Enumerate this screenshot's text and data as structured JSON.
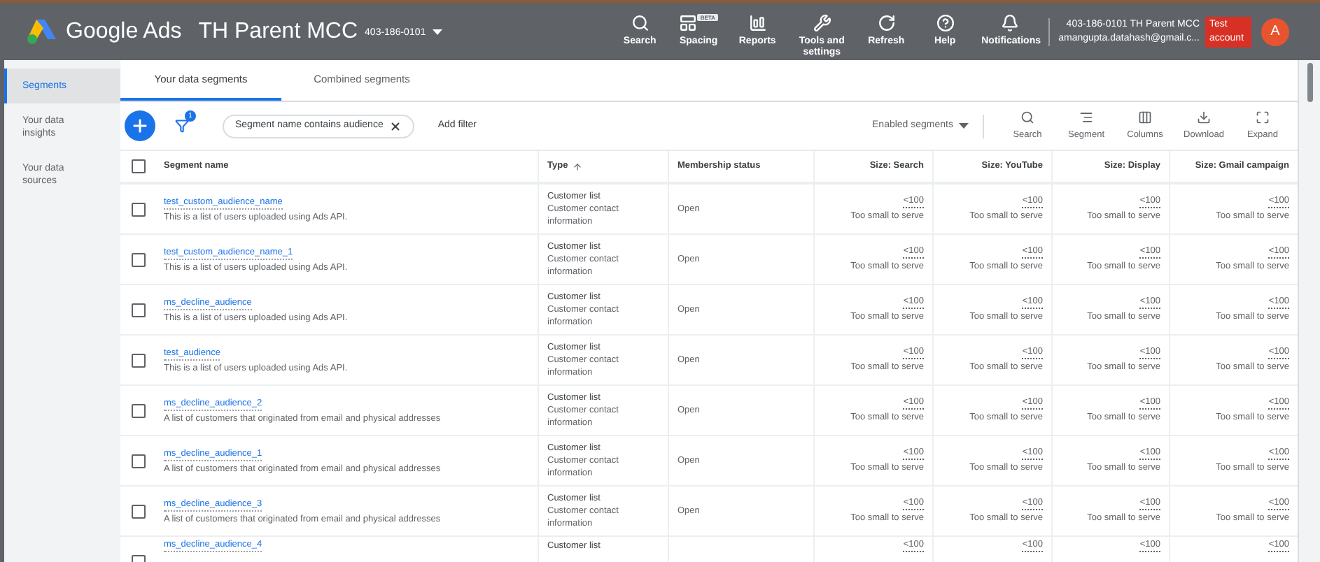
{
  "header": {
    "product": "Google Ads",
    "account_name": "TH Parent MCC",
    "account_id": "403-186-0101",
    "nav": [
      {
        "kind": "search",
        "label": "Search"
      },
      {
        "kind": "spacing",
        "label": "Spacing",
        "badge": "BETA"
      },
      {
        "kind": "reports",
        "label": "Reports"
      },
      {
        "kind": "tools",
        "label": "Tools and settings"
      },
      {
        "kind": "refresh",
        "label": "Refresh"
      },
      {
        "kind": "help",
        "label": "Help"
      },
      {
        "kind": "notifications",
        "label": "Notifications"
      }
    ],
    "user": {
      "account": "403-186-0101 TH Parent MCC",
      "email": "amangupta.datahash@gmail.c...",
      "badge": "Test account",
      "avatar": "A"
    }
  },
  "sidebar": {
    "items": [
      {
        "label": "Segments",
        "selected": true
      },
      {
        "label": "Your data insights",
        "selected": false
      },
      {
        "label": "Your data sources",
        "selected": false
      }
    ]
  },
  "tabs": [
    {
      "label": "Your data segments",
      "selected": true
    },
    {
      "label": "Combined segments",
      "selected": false
    }
  ],
  "toolbar": {
    "filter_count": "1",
    "filter_chip": "Segment name contains audience",
    "add_filter": "Add filter",
    "status_dropdown": "Enabled segments",
    "actions": [
      {
        "kind": "search",
        "label": "Search"
      },
      {
        "kind": "segment",
        "label": "Segment"
      },
      {
        "kind": "columns",
        "label": "Columns"
      },
      {
        "kind": "download",
        "label": "Download"
      },
      {
        "kind": "expand",
        "label": "Expand"
      }
    ]
  },
  "table": {
    "select_all_checked": false,
    "columns": [
      {
        "label": "Segment name",
        "sorted": false
      },
      {
        "label": "Type",
        "sorted": true
      },
      {
        "label": "Membership status",
        "sorted": false
      },
      {
        "label": "Size: Search",
        "sorted": false
      },
      {
        "label": "Size: YouTube",
        "sorted": false
      },
      {
        "label": "Size: Display",
        "sorted": false
      },
      {
        "label": "Size: Gmail campaign",
        "sorted": false
      }
    ],
    "rows": [
      {
        "checked": false,
        "name": "test_custom_audience_name",
        "description": "This is a list of users uploaded using Ads API.",
        "type": "Customer list",
        "type_detail": "Customer contact information",
        "status": "Open",
        "sizes": [
          {
            "value": "<100",
            "note": "Too small to serve"
          },
          {
            "value": "<100",
            "note": "Too small to serve"
          },
          {
            "value": "<100",
            "note": "Too small to serve"
          },
          {
            "value": "<100",
            "note": "Too small to serve"
          }
        ]
      },
      {
        "checked": false,
        "name": "test_custom_audience_name_1",
        "description": "This is a list of users uploaded using Ads API.",
        "type": "Customer list",
        "type_detail": "Customer contact information",
        "status": "Open",
        "sizes": [
          {
            "value": "<100",
            "note": "Too small to serve"
          },
          {
            "value": "<100",
            "note": "Too small to serve"
          },
          {
            "value": "<100",
            "note": "Too small to serve"
          },
          {
            "value": "<100",
            "note": "Too small to serve"
          }
        ]
      },
      {
        "checked": false,
        "name": "ms_decline_audience",
        "description": "This is a list of users uploaded using Ads API.",
        "type": "Customer list",
        "type_detail": "Customer contact information",
        "status": "Open",
        "sizes": [
          {
            "value": "<100",
            "note": "Too small to serve"
          },
          {
            "value": "<100",
            "note": "Too small to serve"
          },
          {
            "value": "<100",
            "note": "Too small to serve"
          },
          {
            "value": "<100",
            "note": "Too small to serve"
          }
        ]
      },
      {
        "checked": false,
        "name": "test_audience",
        "description": "This is a list of users uploaded using Ads API.",
        "type": "Customer list",
        "type_detail": "Customer contact information",
        "status": "Open",
        "sizes": [
          {
            "value": "<100",
            "note": "Too small to serve"
          },
          {
            "value": "<100",
            "note": "Too small to serve"
          },
          {
            "value": "<100",
            "note": "Too small to serve"
          },
          {
            "value": "<100",
            "note": "Too small to serve"
          }
        ]
      },
      {
        "checked": false,
        "name": "ms_decline_audience_2",
        "description": "A list of customers that originated from email and physical addresses",
        "type": "Customer list",
        "type_detail": "Customer contact information",
        "status": "Open",
        "sizes": [
          {
            "value": "<100",
            "note": "Too small to serve"
          },
          {
            "value": "<100",
            "note": "Too small to serve"
          },
          {
            "value": "<100",
            "note": "Too small to serve"
          },
          {
            "value": "<100",
            "note": "Too small to serve"
          }
        ]
      },
      {
        "checked": false,
        "name": "ms_decline_audience_1",
        "description": "A list of customers that originated from email and physical addresses",
        "type": "Customer list",
        "type_detail": "Customer contact information",
        "status": "Open",
        "sizes": [
          {
            "value": "<100",
            "note": "Too small to serve"
          },
          {
            "value": "<100",
            "note": "Too small to serve"
          },
          {
            "value": "<100",
            "note": "Too small to serve"
          },
          {
            "value": "<100",
            "note": "Too small to serve"
          }
        ]
      },
      {
        "checked": false,
        "name": "ms_decline_audience_3",
        "description": "A list of customers that originated from email and physical addresses",
        "type": "Customer list",
        "type_detail": "Customer contact information",
        "status": "Open",
        "sizes": [
          {
            "value": "<100",
            "note": "Too small to serve"
          },
          {
            "value": "<100",
            "note": "Too small to serve"
          },
          {
            "value": "<100",
            "note": "Too small to serve"
          },
          {
            "value": "<100",
            "note": "Too small to serve"
          }
        ]
      },
      {
        "checked": false,
        "name": "ms_decline_audience_4",
        "type": "Customer list",
        "sizes": [
          {
            "value": "<100"
          },
          {
            "value": "<100"
          },
          {
            "value": "<100"
          },
          {
            "value": "<100"
          }
        ]
      }
    ]
  }
}
